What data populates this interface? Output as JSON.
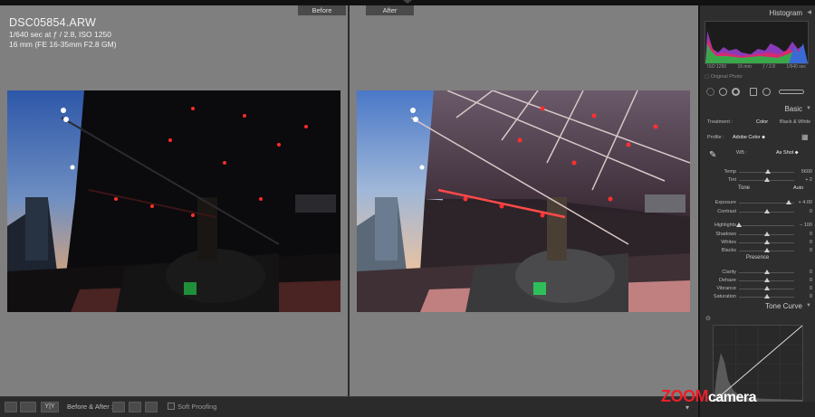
{
  "compare": {
    "before_label": "Before",
    "after_label": "After"
  },
  "image_info": {
    "filename": "DSC05854.ARW",
    "exposure_line": "1/640 sec at ƒ / 2.8, ISO 1250",
    "lens_line": "16 mm (FE 16-35mm F2.8 GM)"
  },
  "toolbar": {
    "before_after_label": "Before & After :",
    "soft_proofing_label": "Soft Proofing",
    "view_yy_label": "Y|Y"
  },
  "histogram": {
    "title": "Histogram",
    "iso": "ISO 1250",
    "focal": "16 mm",
    "aperture": "ƒ / 2.8",
    "shutter": "1/640 sec",
    "original_photo_label": "Original Photo"
  },
  "basic": {
    "title": "Basic",
    "treatment_label": "Treatment :",
    "treatment_color": "Color",
    "treatment_bw": "Black & White",
    "profile_label": "Profile :",
    "profile_value": "Adobe Color ⬥",
    "wb_label": "WB :",
    "wb_value": "As Shot ⬥",
    "tone_label": "Tone",
    "tone_auto": "Auto",
    "presence_label": "Presence",
    "sliders": [
      {
        "label": "Temp",
        "value": "5600",
        "pos": 0.52
      },
      {
        "label": "Tint",
        "value": "+ 2",
        "pos": 0.51
      },
      {
        "label": "Exposure",
        "value": "+ 4.00",
        "pos": 0.9
      },
      {
        "label": "Contrast",
        "value": "0",
        "pos": 0.5
      },
      {
        "label": "Highlights",
        "value": "− 100",
        "pos": 0.0
      },
      {
        "label": "Shadows",
        "value": "0",
        "pos": 0.5
      },
      {
        "label": "Whites",
        "value": "0",
        "pos": 0.5
      },
      {
        "label": "Blacks",
        "value": "0",
        "pos": 0.5
      },
      {
        "label": "Clarity",
        "value": "0",
        "pos": 0.5
      },
      {
        "label": "Dehaze",
        "value": "0",
        "pos": 0.5
      },
      {
        "label": "Vibrance",
        "value": "0",
        "pos": 0.5
      },
      {
        "label": "Saturation",
        "value": "0",
        "pos": 0.5
      }
    ]
  },
  "tone_curve": {
    "title": "Tone Curve"
  },
  "watermark": {
    "zoom": "ZOOM",
    "camera": "camera"
  },
  "colors": {
    "accent_red": "#e8202a",
    "panel_bg": "#2e2e2e",
    "canvas_bg": "#7f7f7f"
  }
}
